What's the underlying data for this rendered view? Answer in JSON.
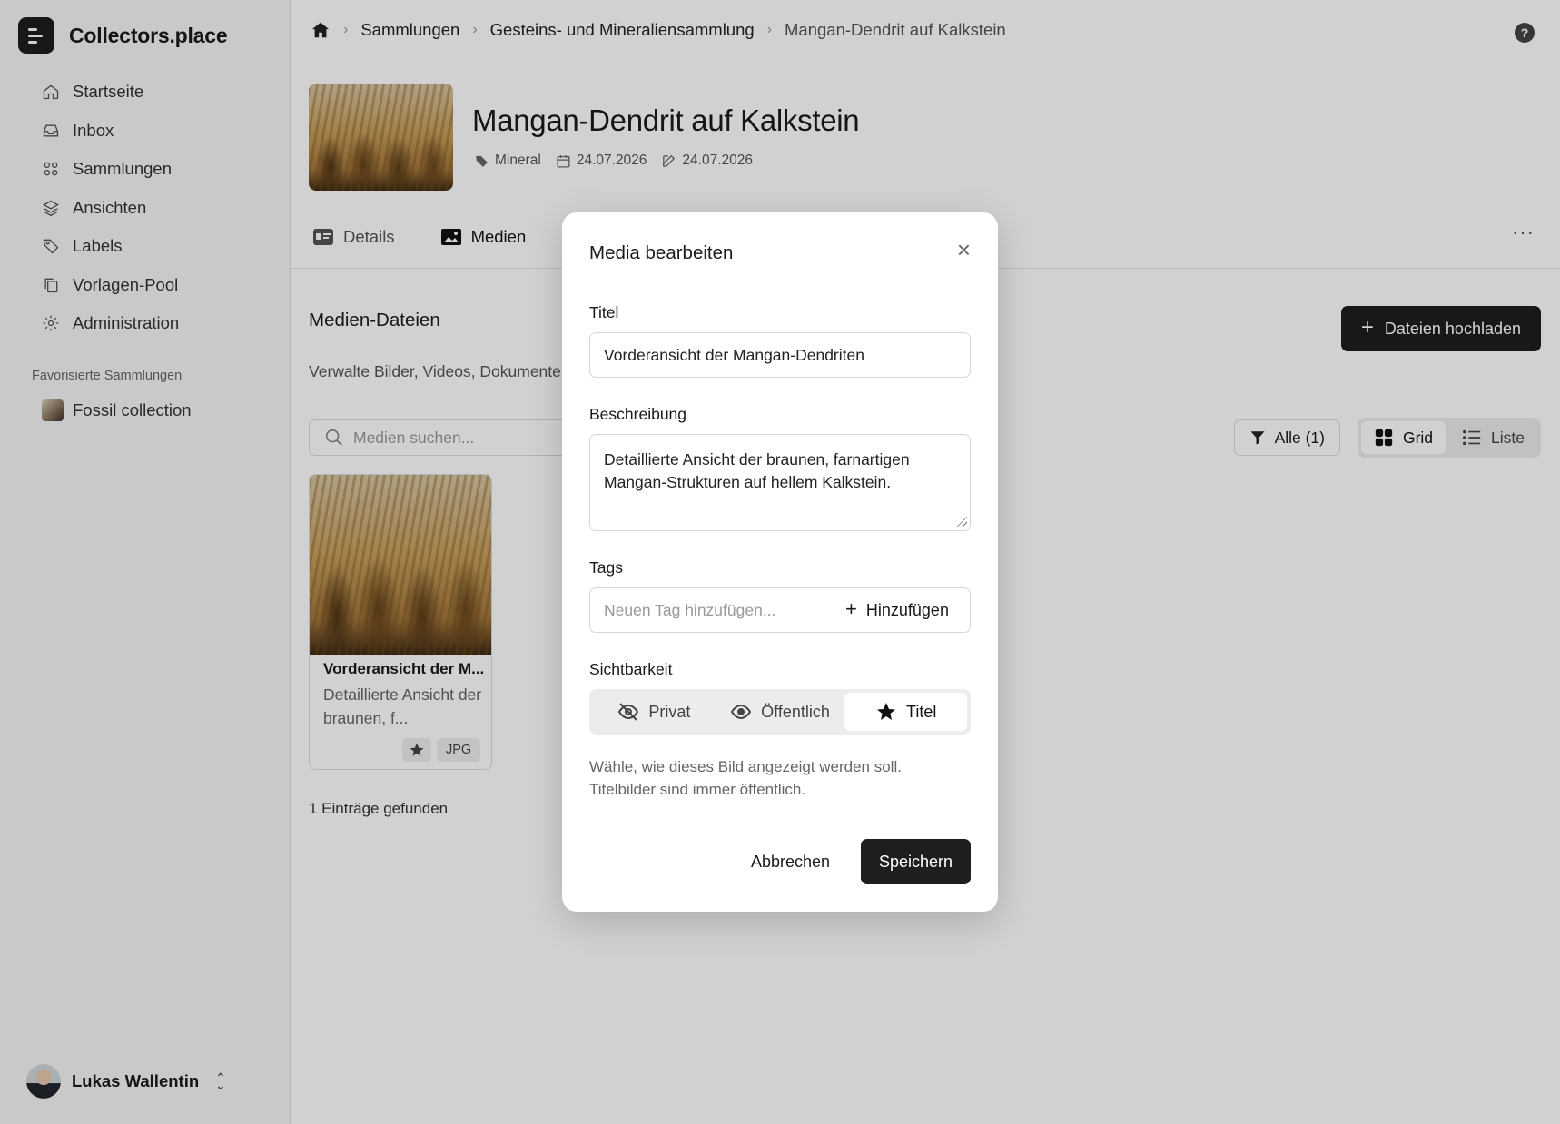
{
  "app": {
    "name": "Collectors.place"
  },
  "sidebar": {
    "items": [
      {
        "label": "Startseite",
        "icon": "home-icon"
      },
      {
        "label": "Inbox",
        "icon": "inbox-icon"
      },
      {
        "label": "Sammlungen",
        "icon": "grid-icon"
      },
      {
        "label": "Ansichten",
        "icon": "layers-icon"
      },
      {
        "label": "Labels",
        "icon": "tag-icon"
      },
      {
        "label": "Vorlagen-Pool",
        "icon": "copy-icon"
      },
      {
        "label": "Administration",
        "icon": "gear-icon"
      }
    ],
    "favorites_heading": "Favorisierte Sammlungen",
    "favorites": [
      {
        "label": "Fossil collection"
      }
    ],
    "user": {
      "name": "Lukas Wallentin"
    }
  },
  "breadcrumb": {
    "items": [
      "Sammlungen",
      "Gesteins- und Mineraliensammlung"
    ],
    "current": "Mangan-Dendrit auf Kalkstein"
  },
  "item": {
    "title": "Mangan-Dendrit auf Kalkstein",
    "label": "Mineral",
    "created": "24.07.2026",
    "modified": "24.07.2026"
  },
  "tabs": [
    {
      "label": "Details",
      "icon": "id-card-icon"
    },
    {
      "label": "Medien",
      "icon": "image-icon",
      "active": true
    }
  ],
  "media": {
    "title": "Medien-Dateien",
    "description": "Verwalte Bilder, Videos, Dokumente",
    "upload_label": "Dateien hochladen",
    "search_placeholder": "Medien suchen...",
    "filter_label": "Alle (1)",
    "view_grid": "Grid",
    "view_list": "Liste",
    "cards": [
      {
        "title": "Vorderansicht der M...",
        "description": "Detaillierte Ansicht der braunen, f...",
        "type": "JPG"
      }
    ],
    "count_text": "1 Einträge gefunden"
  },
  "modal": {
    "title": "Media bearbeiten",
    "title_label": "Titel",
    "title_value": "Vorderansicht der Mangan-Dendriten",
    "description_label": "Beschreibung",
    "description_value": "Detaillierte Ansicht der braunen, farnartigen Mangan-Strukturen auf hellem Kalkstein.",
    "tags_label": "Tags",
    "tags_placeholder": "Neuen Tag hinzufügen...",
    "tags_add": "Hinzufügen",
    "visibility_label": "Sichtbarkeit",
    "visibility_options": [
      {
        "label": "Privat",
        "icon": "eye-off-icon"
      },
      {
        "label": "Öffentlich",
        "icon": "eye-icon"
      },
      {
        "label": "Titel",
        "icon": "star-icon",
        "selected": true
      }
    ],
    "hint": "Wähle, wie dieses Bild angezeigt werden soll. Titelbilder sind immer öffentlich.",
    "cancel_label": "Abbrechen",
    "save_label": "Speichern"
  },
  "colors": {
    "primary": "#1e1e1e",
    "overlay": "rgba(0,0,0,0.18)"
  }
}
